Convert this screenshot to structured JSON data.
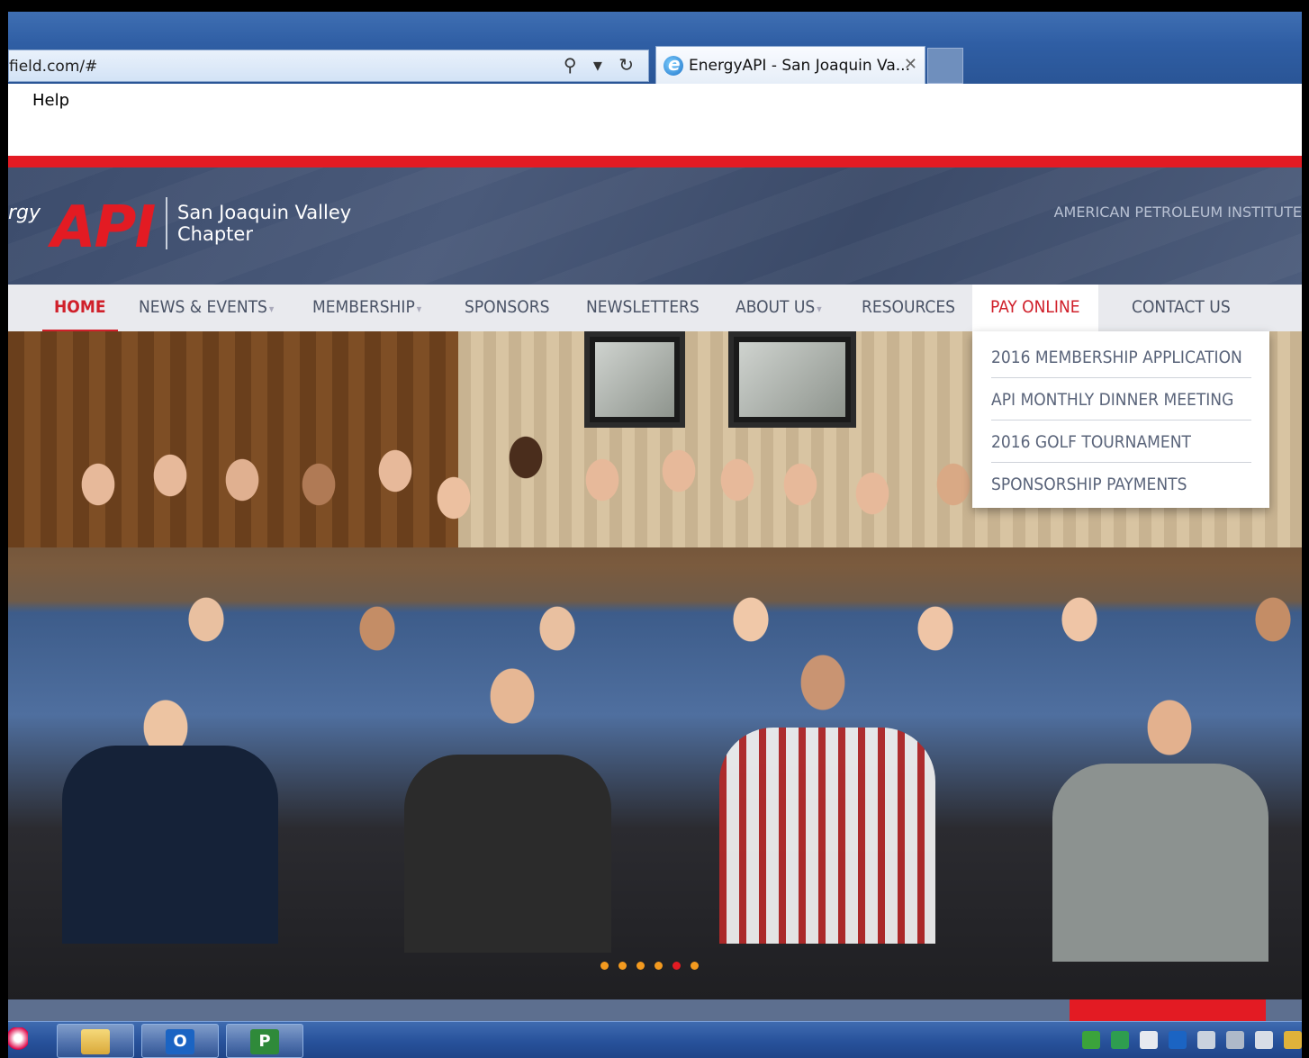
{
  "browser": {
    "address_text": "field.com/#",
    "tab_title": "EnergyAPI - San Joaquin Va...",
    "tab_close": "✕",
    "menu_help": "Help",
    "search_glyph": "⚲ ▾ ↻"
  },
  "header": {
    "logo_energy": "rgy",
    "logo_api": "API",
    "chapter_line1": "San Joaquin Valley",
    "chapter_line2": "Chapter",
    "org_name": "AMERICAN PETROLEUM INSTITUTE"
  },
  "nav": {
    "home": "HOME",
    "news": "NEWS & EVENTS",
    "membership": "MEMBERSHIP",
    "sponsors": "SPONSORS",
    "newsletters": "NEWSLETTERS",
    "about": "ABOUT US",
    "resources": "RESOURCES",
    "pay_online": "PAY ONLINE",
    "contact": "CONTACT US",
    "caret": "▾"
  },
  "dropdown": {
    "items": [
      "2016 MEMBERSHIP APPLICATION",
      "API MONTHLY DINNER MEETING",
      "2016 GOLF TOURNAMENT",
      "SPONSORSHIP PAYMENTS"
    ]
  },
  "taskbar": {
    "outlook_label": "O",
    "project_label": "P"
  },
  "colors": {
    "accent_red": "#e31b23",
    "nav_text": "#4a5366",
    "header_bg": "#3c4c6c"
  }
}
